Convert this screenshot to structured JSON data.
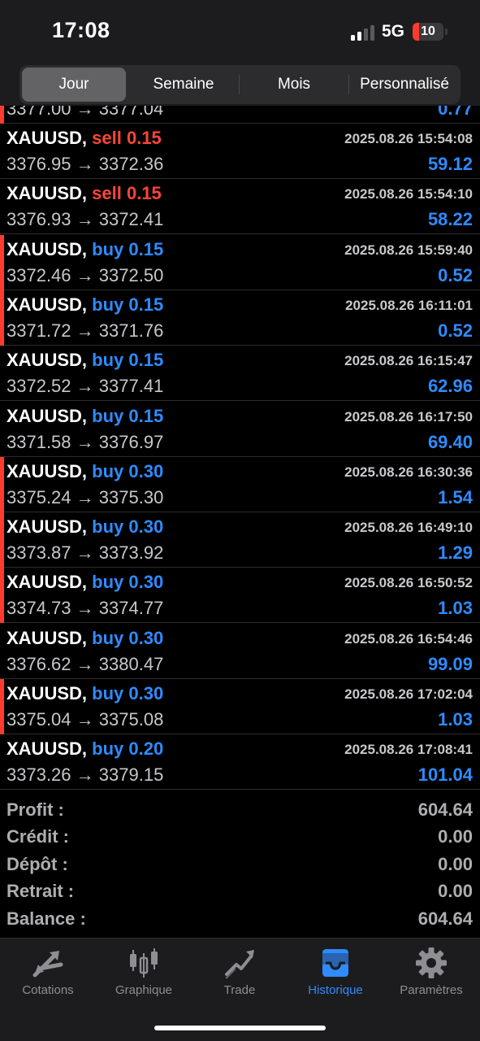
{
  "status_bar": {
    "time": "17:08",
    "network": "5G",
    "battery": "10"
  },
  "period_tabs": [
    {
      "label": "Jour",
      "active": true
    },
    {
      "label": "Semaine",
      "active": false
    },
    {
      "label": "Mois",
      "active": false
    },
    {
      "label": "Personnalisé",
      "active": false
    }
  ],
  "colors": {
    "buy": "#2f8bff",
    "sell": "#ff453a",
    "marker": "#ff3b30",
    "accent": "#2f8bff"
  },
  "partial_row": {
    "prices": "3377.00 → 3377.04",
    "profit": "0.77"
  },
  "deals": [
    {
      "symbol": "XAUUSD,",
      "side": "sell",
      "volume": "0.15",
      "time": "2025.08.26 15:54:08",
      "open": "3376.95",
      "close": "3372.36",
      "profit": "59.12",
      "marker": false
    },
    {
      "symbol": "XAUUSD,",
      "side": "sell",
      "volume": "0.15",
      "time": "2025.08.26 15:54:10",
      "open": "3376.93",
      "close": "3372.41",
      "profit": "58.22",
      "marker": false
    },
    {
      "symbol": "XAUUSD,",
      "side": "buy",
      "volume": "0.15",
      "time": "2025.08.26 15:59:40",
      "open": "3372.46",
      "close": "3372.50",
      "profit": "0.52",
      "marker": true
    },
    {
      "symbol": "XAUUSD,",
      "side": "buy",
      "volume": "0.15",
      "time": "2025.08.26 16:11:01",
      "open": "3371.72",
      "close": "3371.76",
      "profit": "0.52",
      "marker": true
    },
    {
      "symbol": "XAUUSD,",
      "side": "buy",
      "volume": "0.15",
      "time": "2025.08.26 16:15:47",
      "open": "3372.52",
      "close": "3377.41",
      "profit": "62.96",
      "marker": false
    },
    {
      "symbol": "XAUUSD,",
      "side": "buy",
      "volume": "0.15",
      "time": "2025.08.26 16:17:50",
      "open": "3371.58",
      "close": "3376.97",
      "profit": "69.40",
      "marker": false
    },
    {
      "symbol": "XAUUSD,",
      "side": "buy",
      "volume": "0.30",
      "time": "2025.08.26 16:30:36",
      "open": "3375.24",
      "close": "3375.30",
      "profit": "1.54",
      "marker": true
    },
    {
      "symbol": "XAUUSD,",
      "side": "buy",
      "volume": "0.30",
      "time": "2025.08.26 16:49:10",
      "open": "3373.87",
      "close": "3373.92",
      "profit": "1.29",
      "marker": true
    },
    {
      "symbol": "XAUUSD,",
      "side": "buy",
      "volume": "0.30",
      "time": "2025.08.26 16:50:52",
      "open": "3374.73",
      "close": "3374.77",
      "profit": "1.03",
      "marker": true
    },
    {
      "symbol": "XAUUSD,",
      "side": "buy",
      "volume": "0.30",
      "time": "2025.08.26 16:54:46",
      "open": "3376.62",
      "close": "3380.47",
      "profit": "99.09",
      "marker": false
    },
    {
      "symbol": "XAUUSD,",
      "side": "buy",
      "volume": "0.30",
      "time": "2025.08.26 17:02:04",
      "open": "3375.04",
      "close": "3375.08",
      "profit": "1.03",
      "marker": true
    },
    {
      "symbol": "XAUUSD,",
      "side": "buy",
      "volume": "0.20",
      "time": "2025.08.26 17:08:41",
      "open": "3373.26",
      "close": "3379.15",
      "profit": "101.04",
      "marker": false
    }
  ],
  "summary": [
    {
      "label": "Profit :",
      "value": "604.64"
    },
    {
      "label": "Crédit :",
      "value": "0.00"
    },
    {
      "label": "Dépôt :",
      "value": "0.00"
    },
    {
      "label": "Retrait :",
      "value": "0.00"
    },
    {
      "label": "Balance :",
      "value": "604.64"
    }
  ],
  "tabbar": [
    {
      "label": "Cotations",
      "icon": "quotes-arrows-icon",
      "active": false
    },
    {
      "label": "Graphique",
      "icon": "candlestick-chart-icon",
      "active": false
    },
    {
      "label": "Trade",
      "icon": "trend-line-icon",
      "active": false
    },
    {
      "label": "Historique",
      "icon": "inbox-tray-icon",
      "active": true
    },
    {
      "label": "Paramètres",
      "icon": "gear-icon",
      "active": false
    }
  ]
}
